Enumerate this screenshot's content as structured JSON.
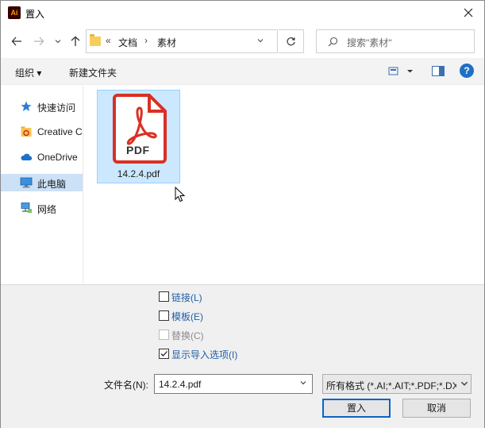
{
  "window": {
    "title": "置入",
    "app_icon_text": "Ai"
  },
  "nav": {
    "breadcrumb": [
      "«",
      "文档",
      "›",
      "素材"
    ],
    "search_placeholder": "搜索\"素材\""
  },
  "toolbar": {
    "organize": "组织 ▾",
    "new_folder": "新建文件夹"
  },
  "sidebar": {
    "items": [
      {
        "label": "快速访问",
        "icon": "star-icon"
      },
      {
        "label": "Creative C",
        "icon": "creative-cloud-icon"
      },
      {
        "label": "OneDrive",
        "icon": "cloud-icon"
      },
      {
        "label": "此电脑",
        "icon": "computer-icon",
        "selected": true
      },
      {
        "label": "网络",
        "icon": "network-icon"
      }
    ]
  },
  "files": [
    {
      "name": "14.2.4.pdf",
      "icon": "pdf-file-icon",
      "badge": "PDF",
      "selected": true
    }
  ],
  "options": [
    {
      "label": "链接(L)",
      "checked": false,
      "enabled": true
    },
    {
      "label": "模板(E)",
      "checked": false,
      "enabled": true
    },
    {
      "label": "替换(C)",
      "checked": false,
      "enabled": false
    },
    {
      "label": "显示导入选项(I)",
      "checked": true,
      "enabled": true
    }
  ],
  "filename": {
    "label": "文件名(N):",
    "value": "14.2.4.pdf"
  },
  "format": {
    "value": "所有格式 (*.AI;*.AIT;*.PDF;*.DXF"
  },
  "buttons": {
    "place": "置入",
    "cancel": "取消"
  },
  "colors": {
    "accent": "#0a64c8",
    "selection": "#cce8ff",
    "pdf_red": "#d93025"
  }
}
